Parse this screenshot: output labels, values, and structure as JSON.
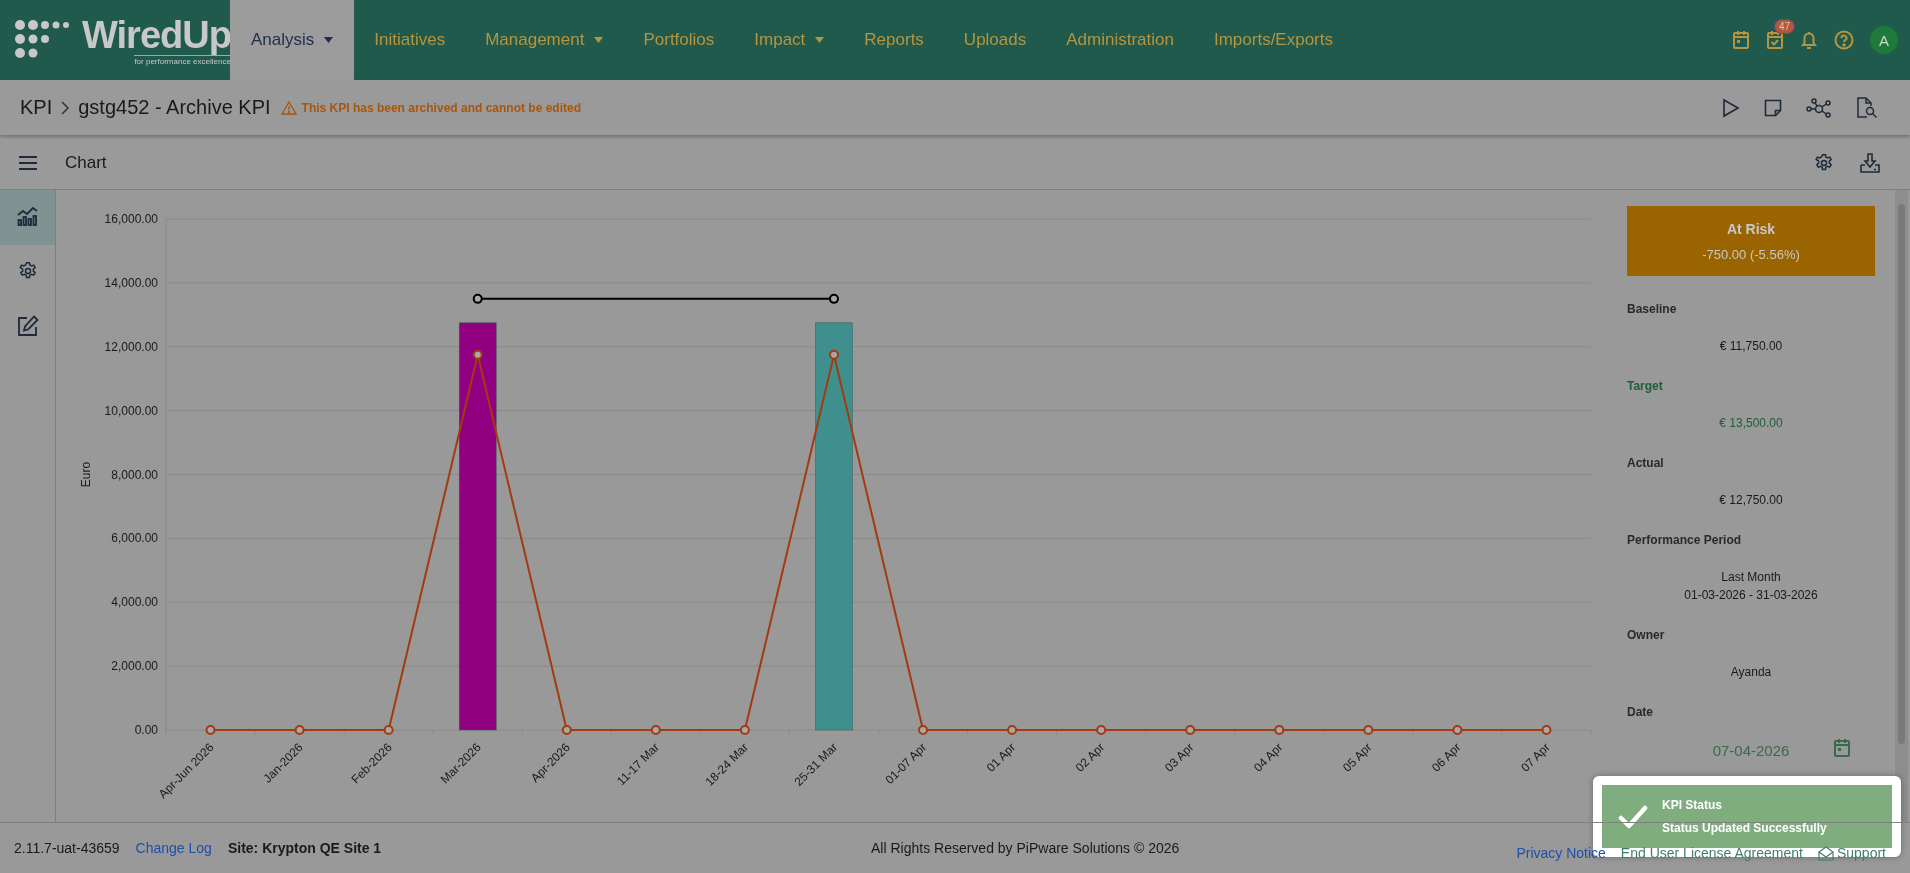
{
  "header": {
    "logo": {
      "name": "WiredUp",
      "tagline": "for performance excellence"
    },
    "nav": [
      {
        "label": "Analysis",
        "selected": true,
        "dropdown": true
      },
      {
        "label": "Initiatives",
        "selected": false,
        "dropdown": false
      },
      {
        "label": "Management",
        "selected": false,
        "dropdown": true
      },
      {
        "label": "Portfolios",
        "selected": false,
        "dropdown": false
      },
      {
        "label": "Impact",
        "selected": false,
        "dropdown": true
      },
      {
        "label": "Reports",
        "selected": false,
        "dropdown": false
      },
      {
        "label": "Uploads",
        "selected": false,
        "dropdown": false
      },
      {
        "label": "Administration",
        "selected": false,
        "dropdown": false
      },
      {
        "label": "Imports/Exports",
        "selected": false,
        "dropdown": false
      }
    ],
    "actions": [
      {
        "kind": "calendar"
      },
      {
        "kind": "tasks",
        "badge": "47"
      },
      {
        "kind": "bell"
      },
      {
        "kind": "help"
      },
      {
        "kind": "avatar",
        "label": "A"
      }
    ]
  },
  "breadcrumb": {
    "items": [
      "KPI",
      "gstg452 - Archive KPI"
    ],
    "warning": "This KPI has been archived and cannot be edited",
    "actions": [
      {
        "kind": "play"
      },
      {
        "kind": "note"
      },
      {
        "kind": "network"
      },
      {
        "kind": "doc-search"
      }
    ]
  },
  "chart_toolbar": {
    "title": "Chart",
    "actions": [
      {
        "kind": "settings"
      },
      {
        "kind": "download"
      }
    ]
  },
  "side_rail": {
    "items": [
      {
        "kind": "chart",
        "selected": true
      },
      {
        "kind": "settings",
        "selected": false
      },
      {
        "kind": "edit",
        "selected": false
      }
    ]
  },
  "chart": {
    "chart_data": {
      "type": "bar",
      "ylabel": "Euro",
      "categories": [
        "Apr-Jun 2026",
        "Jan-2026",
        "Feb-2026",
        "Mar-2026",
        "Apr-2026",
        "11-17 Mar",
        "18-24 Mar",
        "25-31 Mar",
        "01-07 Apr",
        "01 Apr",
        "02 Apr",
        "03 Apr",
        "04 Apr",
        "05 Apr",
        "06 Apr",
        "07 Apr"
      ],
      "stacked": true,
      "grid": true,
      "series": [
        {
          "type": "bar",
          "color": "#900080",
          "values": [
            null,
            null,
            null,
            12750,
            null,
            null,
            null,
            null,
            null,
            null,
            null,
            null,
            null,
            null,
            null,
            null
          ]
        },
        {
          "type": "bar",
          "color": "#3f8f8f",
          "values": [
            null,
            null,
            null,
            null,
            null,
            null,
            null,
            12750,
            null,
            null,
            null,
            null,
            null,
            null,
            null,
            null
          ]
        },
        {
          "type": "line",
          "color": "#a33a10",
          "marker": true,
          "values": [
            0,
            0,
            0,
            11750,
            0,
            0,
            0,
            11750,
            0,
            0,
            0,
            0,
            0,
            0,
            0,
            0
          ]
        },
        {
          "type": "line",
          "color": "#000000",
          "marker": true,
          "values": [
            null,
            null,
            null,
            13500,
            null,
            null,
            null,
            13500,
            null,
            null,
            null,
            null,
            null,
            null,
            null,
            null
          ]
        }
      ],
      "ylim": [
        0,
        16000
      ],
      "yticks": [
        {
          "value": 0,
          "label": "0.00"
        },
        {
          "value": 2000,
          "label": "2,000.00"
        },
        {
          "value": 4000,
          "label": "4,000.00"
        },
        {
          "value": 6000,
          "label": "6,000.00"
        },
        {
          "value": 8000,
          "label": "8,000.00"
        },
        {
          "value": 10000,
          "label": "10,000.00"
        },
        {
          "value": 12000,
          "label": "12,000.00"
        },
        {
          "value": 14000,
          "label": "14,000.00"
        },
        {
          "value": 16000,
          "label": "16,000.00"
        }
      ]
    }
  },
  "panel": {
    "status": {
      "label": "At Risk",
      "value": "-750.00 (-5.56%)",
      "color": "#9a6400"
    },
    "fields": [
      {
        "kind": "text",
        "label": "Baseline",
        "values": [
          "€ 11,750.00"
        ],
        "highlight": false
      },
      {
        "kind": "text",
        "label": "Target",
        "values": [
          "€ 13,500.00"
        ],
        "highlight": true
      },
      {
        "kind": "text",
        "label": "Actual",
        "values": [
          "€ 12,750.00"
        ],
        "highlight": false
      },
      {
        "kind": "text",
        "label": "Performance Period",
        "values": [
          "Last Month",
          "01-03-2026 - 31-03-2026"
        ],
        "highlight": false
      },
      {
        "kind": "text",
        "label": "Owner",
        "values": [
          "Ayanda"
        ],
        "highlight": false
      },
      {
        "kind": "date",
        "label": "Date",
        "values": [
          "07-04-2026"
        ],
        "highlight": false
      }
    ]
  },
  "footer": {
    "version": "2.11.7-uat-43659",
    "change_log": "Change Log",
    "site": "Site: Krypton QE Site 1",
    "copyright": "All Rights Reserved by PiPware Solutions © 2026",
    "links": [
      {
        "kind": "privacy",
        "label": "Privacy Notice"
      },
      {
        "kind": "eula",
        "label": "End User License Agreement"
      },
      {
        "kind": "support",
        "label": "Support"
      }
    ]
  },
  "toast": {
    "kind": "success",
    "title": "KPI Status",
    "message": "Status Updated Successfully"
  }
}
